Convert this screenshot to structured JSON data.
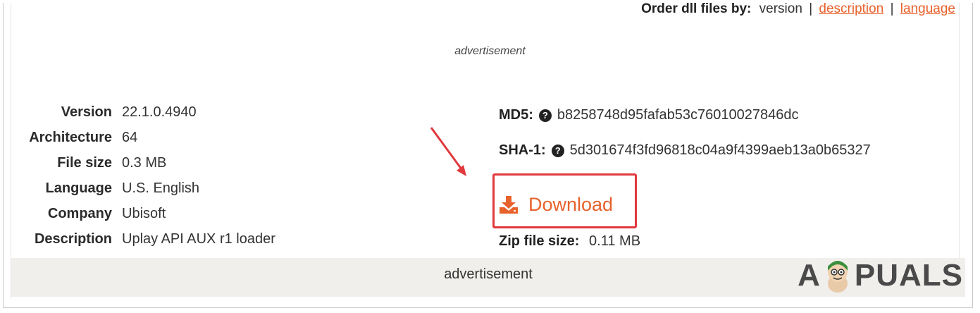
{
  "order": {
    "label": "Order dll files by:",
    "current": "version",
    "options": [
      "description",
      "language"
    ],
    "separator": "|"
  },
  "ad_top": "advertisement",
  "details": [
    {
      "key": "Version",
      "value": "22.1.0.4940"
    },
    {
      "key": "Architecture",
      "value": "64"
    },
    {
      "key": "File size",
      "value": "0.3 MB"
    },
    {
      "key": "Language",
      "value": "U.S. English"
    },
    {
      "key": "Company",
      "value": "Ubisoft"
    },
    {
      "key": "Description",
      "value": "Uplay API AUX r1 loader"
    }
  ],
  "hashes": {
    "md5_label": "MD5:",
    "md5_value": "b8258748d95fafab53c76010027846dc",
    "sha1_label": "SHA-1:",
    "sha1_value": "5d301674f3fd96818c04a9f4399aeb13a0b65327",
    "help_glyph": "?"
  },
  "download": {
    "label": "Download",
    "icon": "download-icon",
    "color": "#e8622c",
    "highlight_color": "#e0393e"
  },
  "zip": {
    "label": "Zip file size:",
    "value": "0.11 MB"
  },
  "ad_bottom": "advertisement",
  "watermark": {
    "left": "A",
    "right": "PUALS"
  }
}
